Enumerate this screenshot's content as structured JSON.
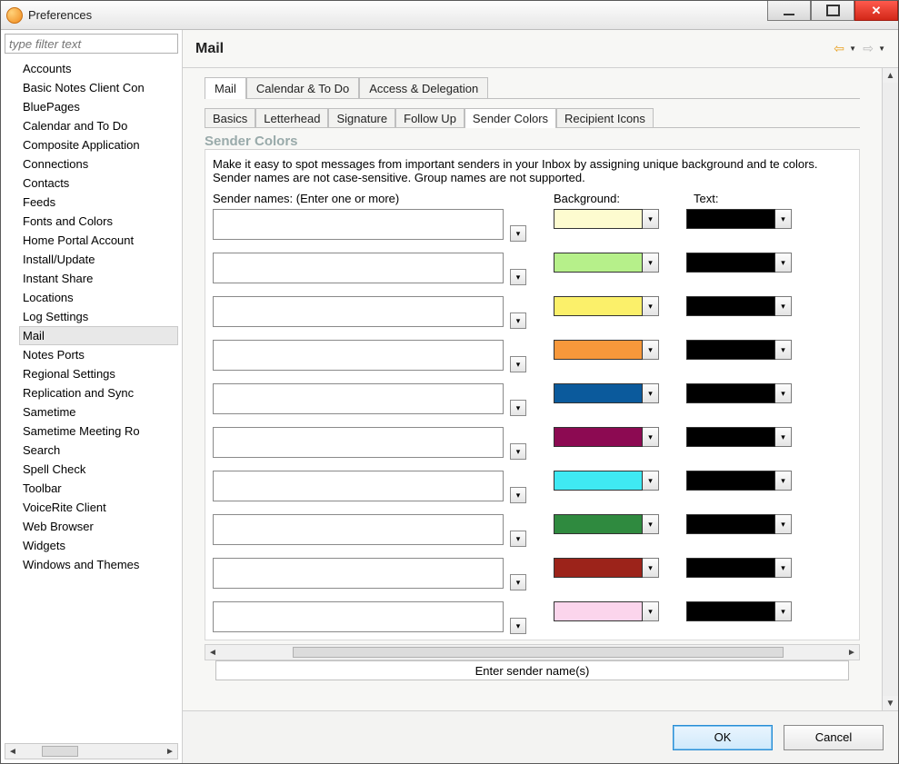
{
  "window": {
    "title": "Preferences"
  },
  "win_buttons": {
    "min": "minimize",
    "max": "maximize",
    "close": "close"
  },
  "sidebar": {
    "filter_placeholder": "type filter text",
    "items": [
      "Accounts",
      "Basic Notes Client Con",
      "BluePages",
      "Calendar and To Do",
      "Composite Application",
      "Connections",
      "Contacts",
      "Feeds",
      "Fonts and Colors",
      "Home Portal Account",
      "Install/Update",
      "Instant Share",
      "Locations",
      "Log Settings",
      "Mail",
      "Notes Ports",
      "Regional Settings",
      "Replication and Sync",
      "Sametime",
      "Sametime Meeting Ro",
      "Search",
      "Spell Check",
      "Toolbar",
      "VoiceRite Client",
      "Web Browser",
      "Widgets",
      "Windows and Themes"
    ],
    "selected_index": 14
  },
  "header": {
    "title": "Mail"
  },
  "tabs_primary": {
    "items": [
      "Mail",
      "Calendar & To Do",
      "Access & Delegation"
    ],
    "active_index": 0
  },
  "tabs_secondary": {
    "items": [
      "Basics",
      "Letterhead",
      "Signature",
      "Follow Up",
      "Sender Colors",
      "Recipient Icons"
    ],
    "active_index": 4
  },
  "section": {
    "title": "Sender Colors",
    "description": "Make it easy to spot messages from important senders in your Inbox by assigning unique background and te colors.  Sender names are not case-sensitive. Group names are not supported.",
    "label_sender": "Sender names: (Enter one or more)",
    "label_background": "Background:",
    "label_text": "Text:"
  },
  "rows": [
    {
      "sender": "",
      "bg": "#FDFBCF",
      "tx": "#000000"
    },
    {
      "sender": "",
      "bg": "#B6F08A",
      "tx": "#000000"
    },
    {
      "sender": "",
      "bg": "#FBF06A",
      "tx": "#000000"
    },
    {
      "sender": "",
      "bg": "#F7983B",
      "tx": "#000000"
    },
    {
      "sender": "",
      "bg": "#0B5A9C",
      "tx": "#000000"
    },
    {
      "sender": "",
      "bg": "#8C0A52",
      "tx": "#000000"
    },
    {
      "sender": "",
      "bg": "#3FE9F3",
      "tx": "#000000"
    },
    {
      "sender": "",
      "bg": "#2F8A3F",
      "tx": "#000000"
    },
    {
      "sender": "",
      "bg": "#9C231A",
      "tx": "#000000"
    },
    {
      "sender": "",
      "bg": "#FBD5EC",
      "tx": "#000000"
    }
  ],
  "status": {
    "text": "Enter sender name(s)"
  },
  "footer": {
    "ok": "OK",
    "cancel": "Cancel"
  }
}
